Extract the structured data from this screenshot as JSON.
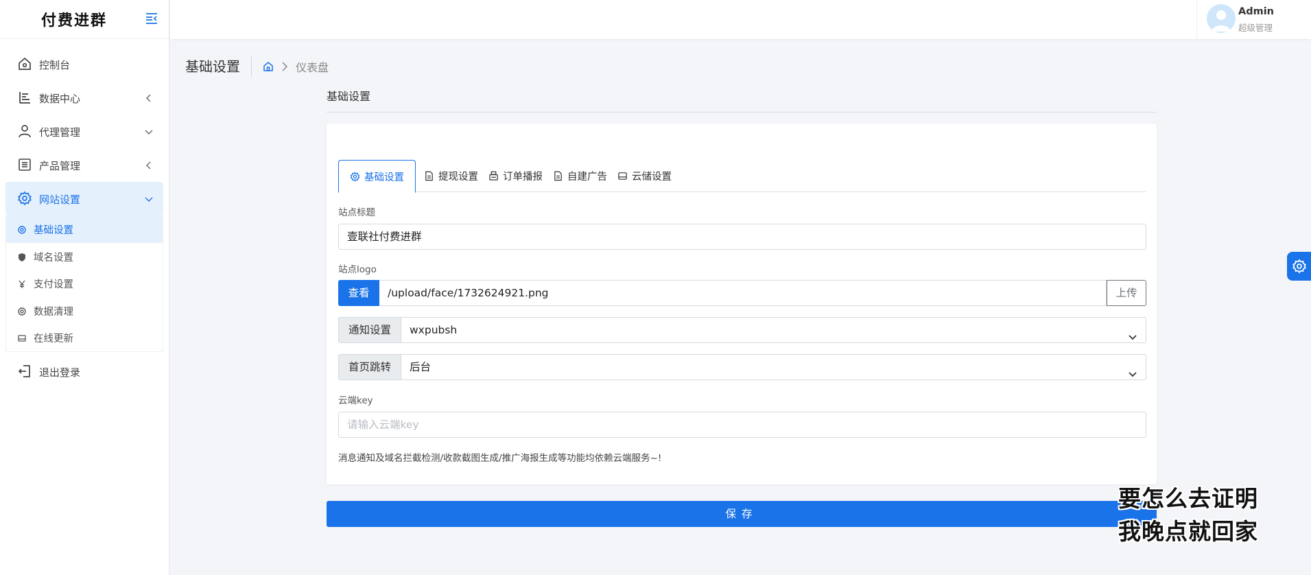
{
  "app": {
    "brand": "付费进群"
  },
  "sidebar": {
    "items": [
      {
        "label": "控制台",
        "icon": "home-icon"
      },
      {
        "label": "数据中心",
        "icon": "chart-bars-icon"
      },
      {
        "label": "代理管理",
        "icon": "user-icon"
      },
      {
        "label": "产品管理",
        "icon": "list-icon"
      },
      {
        "label": "网站设置",
        "icon": "gear-icon"
      }
    ],
    "submenu": [
      {
        "label": "基础设置",
        "icon": "gear-small-icon"
      },
      {
        "label": "域名设置",
        "icon": "shield-icon"
      },
      {
        "label": "支付设置",
        "icon": "yen-icon"
      },
      {
        "label": "数据清理",
        "icon": "gear-small-icon"
      },
      {
        "label": "在线更新",
        "icon": "drive-icon"
      }
    ],
    "logout": {
      "label": "退出登录",
      "icon": "logout-icon"
    }
  },
  "header": {
    "user": {
      "name": "Admin",
      "role": "超级管理"
    }
  },
  "breadcrumb": {
    "title": "基础设置",
    "current": "仪表盘"
  },
  "main": {
    "section_title": "基础设置",
    "tabs": [
      {
        "label": "基础设置",
        "icon": "gear-icon"
      },
      {
        "label": "提现设置",
        "icon": "document-icon"
      },
      {
        "label": "订单播报",
        "icon": "printer-icon"
      },
      {
        "label": "自建广告",
        "icon": "document-icon"
      },
      {
        "label": "云储设置",
        "icon": "drive-icon"
      }
    ],
    "site_title": {
      "label": "站点标题",
      "value": "壹联社付费进群"
    },
    "site_logo": {
      "label": "站点logo",
      "view_button": "查看",
      "path": "/upload/face/1732624921.png",
      "upload_button": "上传"
    },
    "notify": {
      "addon": "通知设置",
      "value": "wxpubsh"
    },
    "home_redirect": {
      "addon": "首页跳转",
      "value": "后台"
    },
    "cloud_key": {
      "label": "云端key",
      "placeholder": "请输入云端key"
    },
    "hint": "消息通知及域名拦截检测/收款截图生成/推广海报生成等功能均依赖云端服务~!",
    "save_button": "保存"
  },
  "overlay_caption": {
    "line1": "要怎么去证明",
    "line2": "我晚点就回家"
  },
  "colors": {
    "accent": "#1a73e8",
    "active_bg": "#e5f0fd",
    "page_bg": "#f3f5f8"
  }
}
